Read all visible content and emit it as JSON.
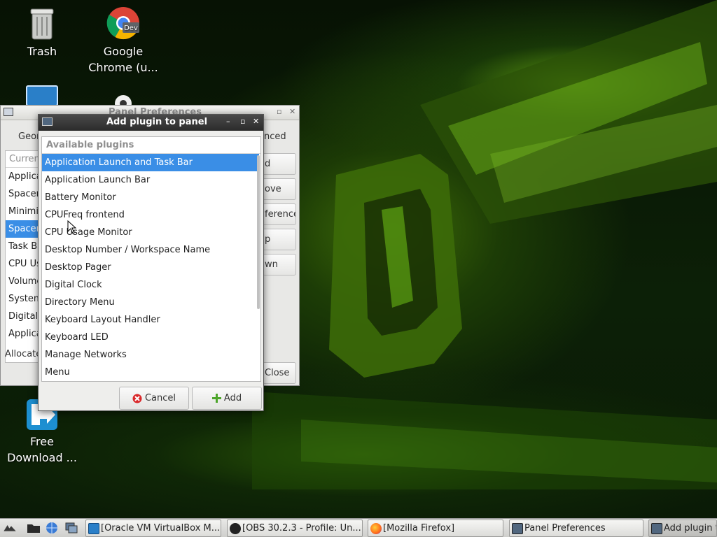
{
  "desktop": {
    "icons": [
      {
        "label_line1": "Trash",
        "label_line2": "",
        "icon": "trash-icon"
      },
      {
        "label_line1": "Google",
        "label_line2": "Chrome (u...",
        "icon": "chrome-dev-icon",
        "badge": "Dev"
      },
      {
        "label_line1": "Free",
        "label_line2": "Download ...",
        "icon": "free-download-manager-icon"
      }
    ]
  },
  "prefs_window": {
    "title": "Panel Preferences",
    "tabs": [
      "Geom",
      "nced"
    ],
    "list_header": "Curren",
    "items": [
      "Applica",
      "Spacer",
      "Minimiz",
      "Spacer",
      "Task Ba",
      "CPU Us",
      "Volume",
      "System",
      "Digital C",
      "Applica"
    ],
    "selected_index": 3,
    "status": "Allocate",
    "buttons": [
      "d",
      "ove",
      "ferences",
      "p",
      "wn"
    ],
    "close_label": "Close"
  },
  "dialog": {
    "title": "Add plugin to panel",
    "list_header": "Available plugins",
    "plugins": [
      "Application Launch and Task Bar",
      "Application Launch Bar",
      "Battery Monitor",
      "CPUFreq frontend",
      "CPU Usage Monitor",
      "Desktop Number / Workspace Name",
      "Desktop Pager",
      "Digital Clock",
      "Directory Menu",
      "Keyboard Layout Handler",
      "Keyboard LED",
      "Manage Networks",
      "Menu"
    ],
    "selected_index": 0,
    "cancel_label": "Cancel",
    "add_label": "Add",
    "colors": {
      "selection": "#3a8ee6",
      "cancel_icon": "#d9282a",
      "add_icon": "#4da52a"
    }
  },
  "taskbar": {
    "tasks": [
      {
        "label": "[Oracle VM VirtualBox M...",
        "icon": "virtualbox-icon"
      },
      {
        "label": "[OBS 30.2.3 - Profile: Un...",
        "icon": "obs-icon"
      },
      {
        "label": "[Mozilla Firefox]",
        "icon": "firefox-icon"
      },
      {
        "label": "Panel Preferences",
        "icon": "panel-preferences-icon"
      },
      {
        "label": "Add plugin t",
        "icon": "add-plugin-icon"
      }
    ]
  }
}
